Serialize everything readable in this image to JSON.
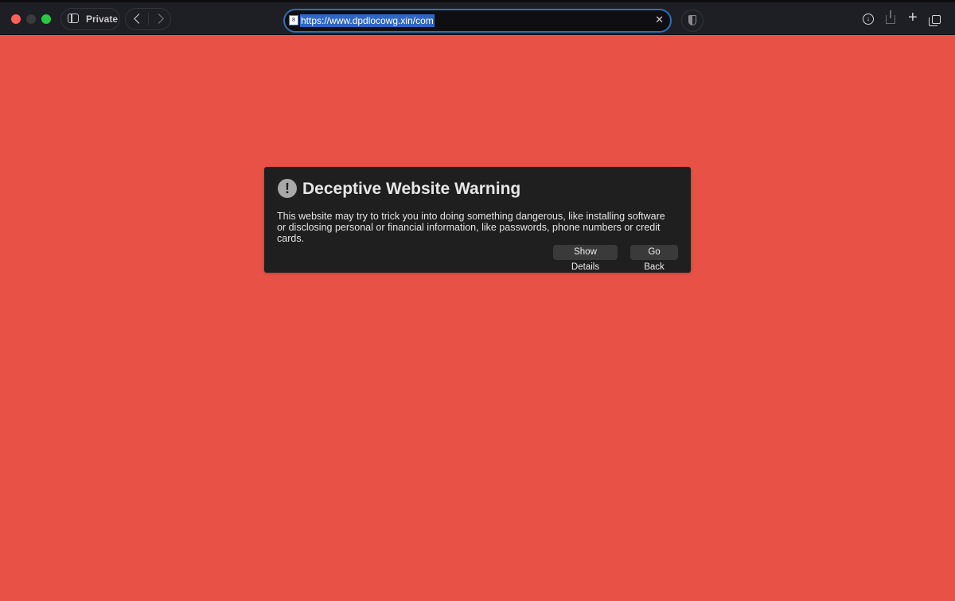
{
  "browser": {
    "private_label": "Private",
    "url": "https://www.dpdlocowg.xin/com",
    "favicon_text": "8"
  },
  "warning": {
    "title": "Deceptive Website Warning",
    "body": "This website may try to trick you into doing something dangerous, like installing software or disclosing personal or financial information, like passwords, phone numbers or credit cards.",
    "show_details_label": "Show Details",
    "go_back_label": "Go Back",
    "icon": "exclamation-icon"
  },
  "colors": {
    "page_background": "#e85146",
    "panel_background": "#1f1f1f",
    "url_selection": "#2f66c7"
  }
}
